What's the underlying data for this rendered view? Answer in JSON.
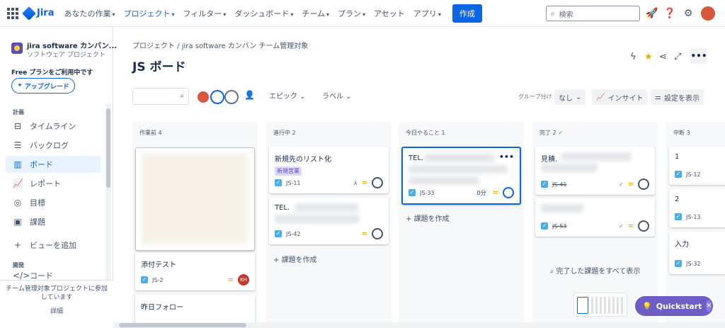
{
  "nav": {
    "brand": "Jira",
    "items": [
      "あなたの作業",
      "プロジェクト",
      "フィルター",
      "ダッシュボード",
      "チーム",
      "プラン",
      "アセット",
      "アプリ"
    ],
    "create": "作成",
    "search_placeholder": "検索"
  },
  "sidebar": {
    "project_name": "jira software カンバン...",
    "project_type": "ソフトウェア プロジェクト",
    "free_plan": "Free プランをご利用中です",
    "upgrade": "アップグレード",
    "section_plan": "計画",
    "items": [
      "タイムライン",
      "バックログ",
      "ボード",
      "レポート",
      "目標",
      "課題"
    ],
    "add_view": "ビューを追加",
    "section_dev": "開発",
    "code": "コード",
    "footer_text": "チーム管理対象プロジェクトに参加しています",
    "footer_link": "詳細"
  },
  "main": {
    "breadcrumb": "プロジェクト / jira software カンバン チーム管理対象",
    "title": "JS ボード",
    "filter_epic": "エピック",
    "filter_label": "ラベル",
    "group_label": "グループ分け",
    "group_value": "なし",
    "insight": "インサイト",
    "display_settings": "設定を表示"
  },
  "columns": [
    {
      "header": "作業前 4",
      "cards": [
        {
          "title": "添付テスト",
          "key": "JS-2",
          "assignee": "KH"
        },
        {
          "title": "昨日フォロー"
        }
      ]
    },
    {
      "header": "進行中 2",
      "cards": [
        {
          "title": "新規先のリスト化",
          "tag": "新規営業",
          "key": "JS-11"
        },
        {
          "title": "TEL.",
          "key": "JS-42"
        }
      ],
      "add": "課題を作成"
    },
    {
      "header": "今日やること 1",
      "cards": [
        {
          "title": "TEL.",
          "key": "JS-33",
          "time": "0分"
        }
      ],
      "add": "課題を作成"
    },
    {
      "header": "完了 2",
      "cards": [
        {
          "title": "見積.",
          "key": "JS-41"
        },
        {
          "key": "JS-53"
        }
      ],
      "show_all": "完了した課題をすべて表示"
    },
    {
      "header": "中断 3",
      "cards": [
        {
          "title": "1",
          "key": "JS-12"
        },
        {
          "title": "2",
          "key": "JS-13"
        },
        {
          "title": "入力",
          "key": "JS-32"
        }
      ]
    }
  ],
  "quickstart": "Quickstart"
}
